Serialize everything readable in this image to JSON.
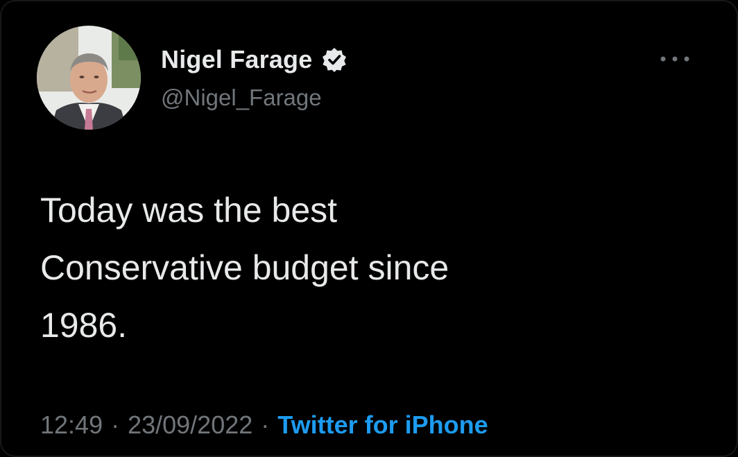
{
  "tweet": {
    "display_name": "Nigel Farage",
    "handle": "@Nigel_Farage",
    "verified": true,
    "text_lines": [
      "Today was the best",
      "Conservative budget since",
      "1986."
    ],
    "time": "12:49",
    "separator": "·",
    "date": "23/09/2022",
    "source": "Twitter for iPhone"
  },
  "icons": {
    "verified": "verified-badge-icon",
    "more": "more-options-icon"
  },
  "colors": {
    "background": "#000000",
    "primary_text": "#e7e9ea",
    "secondary_text": "#71767b",
    "link": "#1d9bf0"
  }
}
